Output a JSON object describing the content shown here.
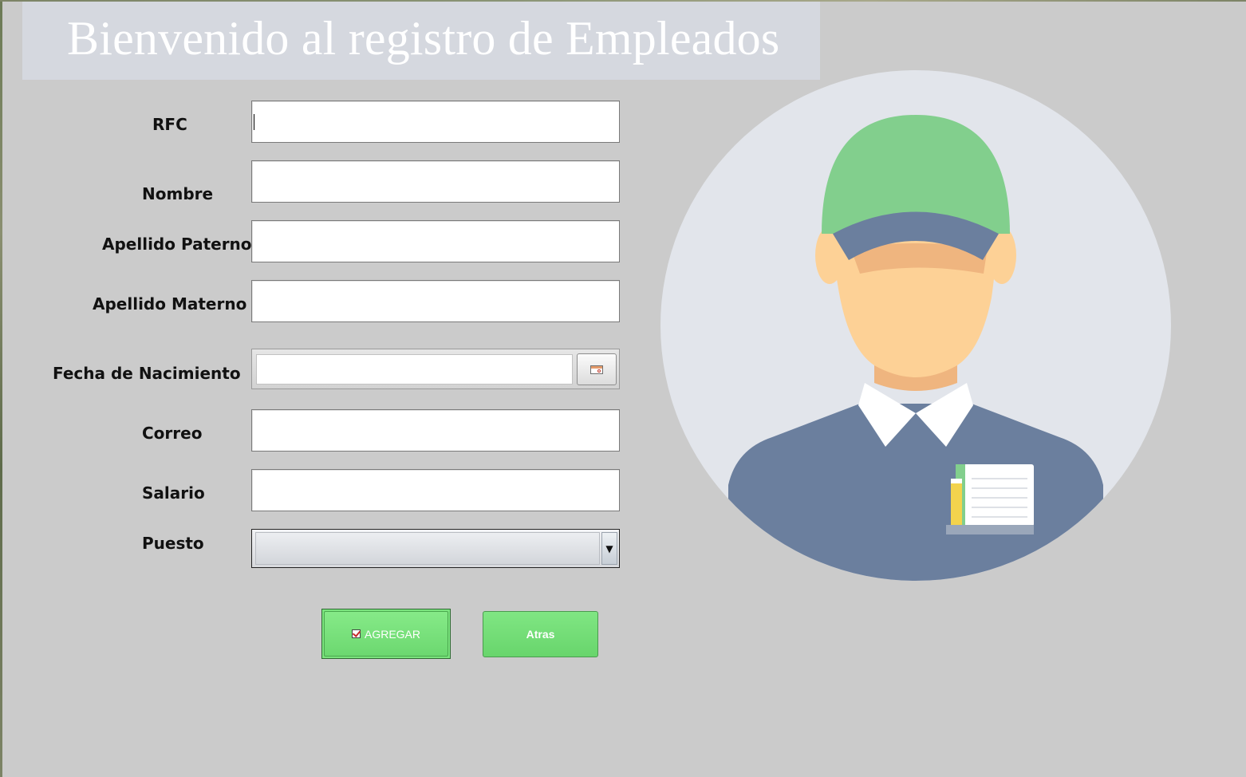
{
  "header": {
    "title": "Bienvenido al registro de Empleados"
  },
  "form": {
    "rfc": {
      "label": "RFC",
      "value": ""
    },
    "nombre": {
      "label": "Nombre",
      "value": ""
    },
    "apellido_paterno": {
      "label": "Apellido Paterno",
      "value": ""
    },
    "apellido_materno": {
      "label": "Apellido Materno",
      "value": ""
    },
    "fecha_nacimiento": {
      "label": "Fecha de Nacimiento",
      "value": ""
    },
    "correo": {
      "label": "Correo",
      "value": ""
    },
    "salario": {
      "label": "Salario",
      "value": ""
    },
    "puesto": {
      "label": "Puesto",
      "selected": ""
    }
  },
  "buttons": {
    "agregar": "AGREGAR",
    "atras": "Atras"
  },
  "colors": {
    "background": "#cbcbcb",
    "title_bar": "#d5d8df",
    "button_green": "#7be47e",
    "avatar_circle": "#e2e5eb",
    "cap_green": "#82cf8d",
    "shirt_blue": "#6b7f9e",
    "skin": "#fdd196"
  },
  "icons": {
    "date_picker": "calendar-icon",
    "select_arrow": "dropdown-arrow-icon",
    "agregar": "checkbox-icon",
    "avatar": "employee-avatar-illustration"
  }
}
